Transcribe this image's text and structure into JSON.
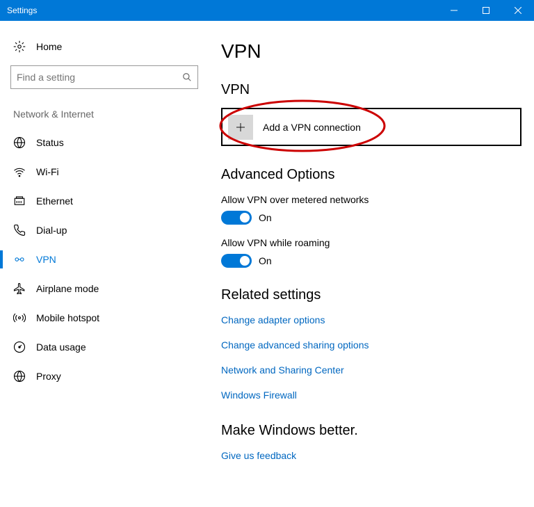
{
  "titlebar": {
    "title": "Settings"
  },
  "sidebar": {
    "home_label": "Home",
    "search_placeholder": "Find a setting",
    "section_label": "Network & Internet",
    "items": [
      {
        "label": "Status"
      },
      {
        "label": "Wi-Fi"
      },
      {
        "label": "Ethernet"
      },
      {
        "label": "Dial-up"
      },
      {
        "label": "VPN",
        "active": true
      },
      {
        "label": "Airplane mode"
      },
      {
        "label": "Mobile hotspot"
      },
      {
        "label": "Data usage"
      },
      {
        "label": "Proxy"
      }
    ]
  },
  "main": {
    "page_title": "VPN",
    "vpn_heading": "VPN",
    "add_vpn_label": "Add a VPN connection",
    "advanced_options_title": "Advanced Options",
    "settings": [
      {
        "label": "Allow VPN over metered networks",
        "value": "On"
      },
      {
        "label": "Allow VPN while roaming",
        "value": "On"
      }
    ],
    "related_settings_title": "Related settings",
    "related_links": [
      "Change adapter options",
      "Change advanced sharing options",
      "Network and Sharing Center",
      "Windows Firewall"
    ],
    "feedback_title": "Make Windows better.",
    "feedback_link": "Give us feedback"
  }
}
